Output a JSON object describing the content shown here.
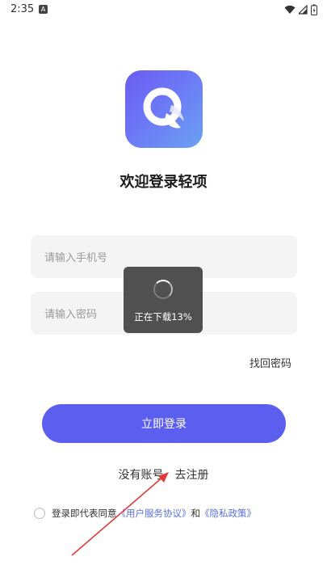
{
  "status_bar": {
    "time": "2:35",
    "notification_icon": "font-A-icon",
    "icons": [
      "wifi-icon",
      "signal-icon",
      "battery-charging-icon"
    ]
  },
  "logo": {
    "icon": "app-logo-q-icon"
  },
  "title": "欢迎登录轻项",
  "login_form": {
    "phone_placeholder": "请输入手机号",
    "password_placeholder": "请输入密码",
    "forgot_password": "找回密码",
    "login_button": "立即登录"
  },
  "register": {
    "prompt": "没有账号",
    "link": "去注册"
  },
  "agreement": {
    "prefix": "登录即代表同意",
    "user_agreement": "《用户服务协议》",
    "and": "和",
    "privacy_policy": "《隐私政策》"
  },
  "toast": {
    "text": "正在下载13%",
    "progress_percent": 13
  },
  "colors": {
    "primary": "#5c5ef0",
    "link": "#5a6fd8",
    "annotation_arrow": "#e23a3a"
  }
}
